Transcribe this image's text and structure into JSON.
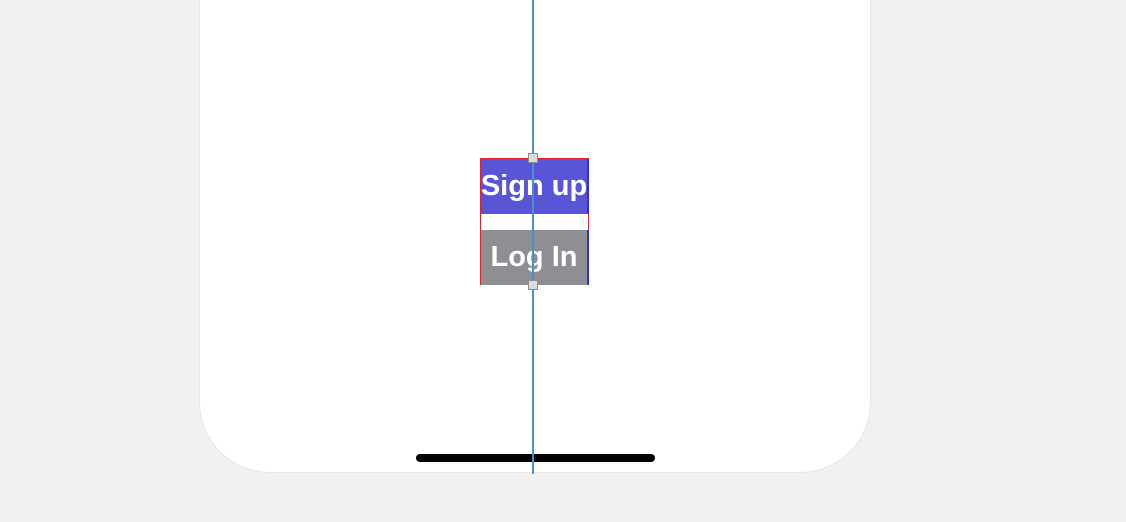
{
  "buttons": {
    "signup_label": "Sign up",
    "login_label": "Log In"
  },
  "colors": {
    "signup_bg": "#5856d6",
    "login_bg": "#8e8e93",
    "selection_border": "#e0202a",
    "guide_line": "#4a90c9",
    "canvas_bg": "#f1f1f1"
  }
}
